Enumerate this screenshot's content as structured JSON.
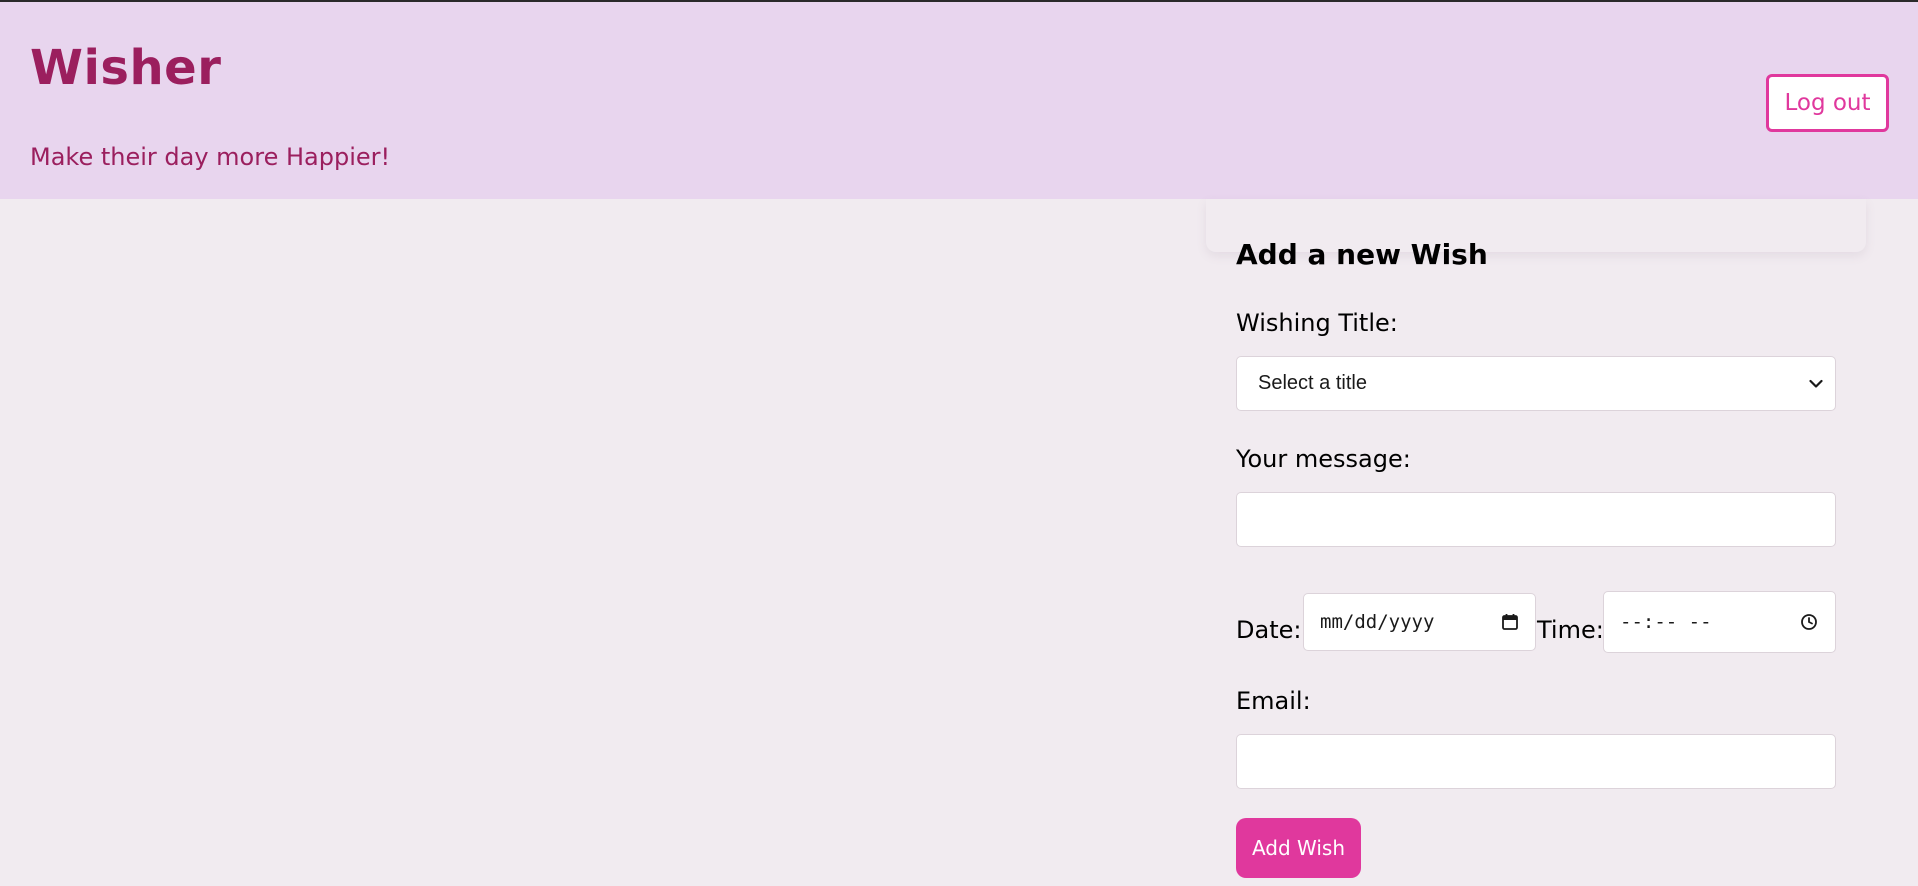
{
  "header": {
    "title": "Wisher",
    "tagline": "Make their day more Happier!",
    "logout_label": "Log out"
  },
  "form": {
    "heading": "Add a new Wish",
    "title_label": "Wishing Title:",
    "title_select_value": "Select a title",
    "message_label": "Your message:",
    "message_value": "",
    "date_label": "Date:",
    "date_placeholder": "mm/dd/yyyy",
    "time_label": "Time:",
    "time_placeholder": "--:-- --",
    "email_label": "Email:",
    "email_value": "",
    "submit_label": "Add Wish"
  },
  "icons": {
    "select": "chevron-down-icon",
    "date": "calendar-icon",
    "time": "clock-icon"
  },
  "colors": {
    "page_background": "#f1ebf0",
    "header_background": "#e8d5ee",
    "brand": "#9b1f5e",
    "accent": "#e0389d",
    "field_background": "#ffffff",
    "field_border": "#dcd3da"
  }
}
